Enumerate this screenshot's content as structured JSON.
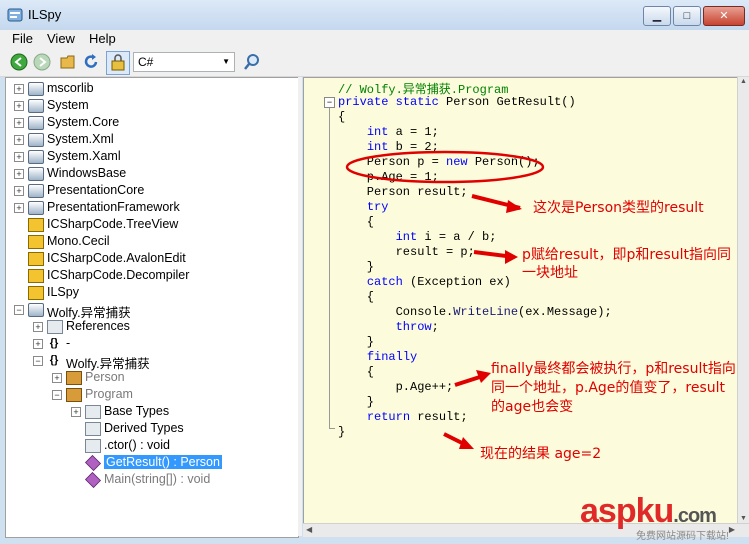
{
  "window": {
    "title": "ILSpy",
    "minimize": "▁",
    "maximize": "□",
    "close": "✕"
  },
  "menu": [
    "File",
    "View",
    "Help"
  ],
  "toolbar": {
    "language": "C#",
    "icons": [
      "back-icon",
      "forward-icon",
      "open-folder-icon",
      "refresh-icon",
      "show-internal-icon",
      "search-icon"
    ]
  },
  "tree": [
    {
      "label": "mscorlib",
      "expander": "+",
      "icon": "assembly"
    },
    {
      "label": "System",
      "expander": "+",
      "icon": "assembly"
    },
    {
      "label": "System.Core",
      "expander": "+",
      "icon": "assembly"
    },
    {
      "label": "System.Xml",
      "expander": "+",
      "icon": "assembly"
    },
    {
      "label": "System.Xaml",
      "expander": "+",
      "icon": "assembly"
    },
    {
      "label": "WindowsBase",
      "expander": "+",
      "icon": "assembly"
    },
    {
      "label": "PresentationCore",
      "expander": "+",
      "icon": "assembly"
    },
    {
      "label": "PresentationFramework",
      "expander": "+",
      "icon": "assembly"
    },
    {
      "label": "ICSharpCode.TreeView",
      "expander": "",
      "icon": "warning"
    },
    {
      "label": "Mono.Cecil",
      "expander": "",
      "icon": "warning"
    },
    {
      "label": "ICSharpCode.AvalonEdit",
      "expander": "",
      "icon": "warning"
    },
    {
      "label": "ICSharpCode.Decompiler",
      "expander": "",
      "icon": "warning"
    },
    {
      "label": "ILSpy",
      "expander": "",
      "icon": "warning"
    },
    {
      "label": "Wolfy.异常捕获",
      "expander": "−",
      "icon": "assembly"
    },
    {
      "label": "References",
      "expander": "+",
      "icon": "references"
    },
    {
      "label": "-",
      "expander": "+",
      "icon": "namespace"
    },
    {
      "label": "Wolfy.异常捕获",
      "expander": "−",
      "icon": "namespace"
    },
    {
      "label": "Person",
      "expander": "+",
      "icon": "class"
    },
    {
      "label": "Program",
      "expander": "−",
      "icon": "class"
    },
    {
      "label": "Base Types",
      "expander": "+",
      "icon": "basetypes"
    },
    {
      "label": "Derived Types",
      "expander": "",
      "icon": "derived"
    },
    {
      "label": ".ctor() : void",
      "expander": "",
      "icon": "ctor"
    },
    {
      "label": "GetResult() : Person",
      "expander": "",
      "icon": "method"
    },
    {
      "label": "Main(string[]) : void",
      "expander": "",
      "icon": "method"
    }
  ],
  "code": [
    "// Wolfy.异常捕获.Program",
    "private static Person GetResult()",
    "{",
    "    int a = 1;",
    "    int b = 2;",
    "    Person p = new Person();",
    "    p.Age = 1;",
    "    Person result;",
    "    try",
    "    {",
    "        int i = a / b;",
    "        result = p;",
    "    }",
    "    catch (Exception ex)",
    "    {",
    "        Console.WriteLine(ex.Message);",
    "        throw;",
    "    }",
    "    finally",
    "    {",
    "        p.Age++;",
    "    }",
    "    return result;",
    "}"
  ],
  "annotations": {
    "a1": "这次是Person类型的result",
    "a2_line1": "p赋给result，即p和result指向同",
    "a2_line2": "一块地址",
    "a3_line1": "finally最终都会被执行，p和result指向",
    "a3_line2": "同一个地址，p.Age的值变了，result",
    "a3_line3": "的age也会变",
    "a4": "现在的结果 age=2"
  },
  "watermark": {
    "brand": "aspku",
    "domain": ".com",
    "tagline": "免费网站源码下载站!"
  },
  "colors": {
    "annotation": "#e00000",
    "keyword": "#0000ff",
    "comment": "#008000",
    "code_bg": "#fcfcdc",
    "selection": "#3399ff"
  }
}
